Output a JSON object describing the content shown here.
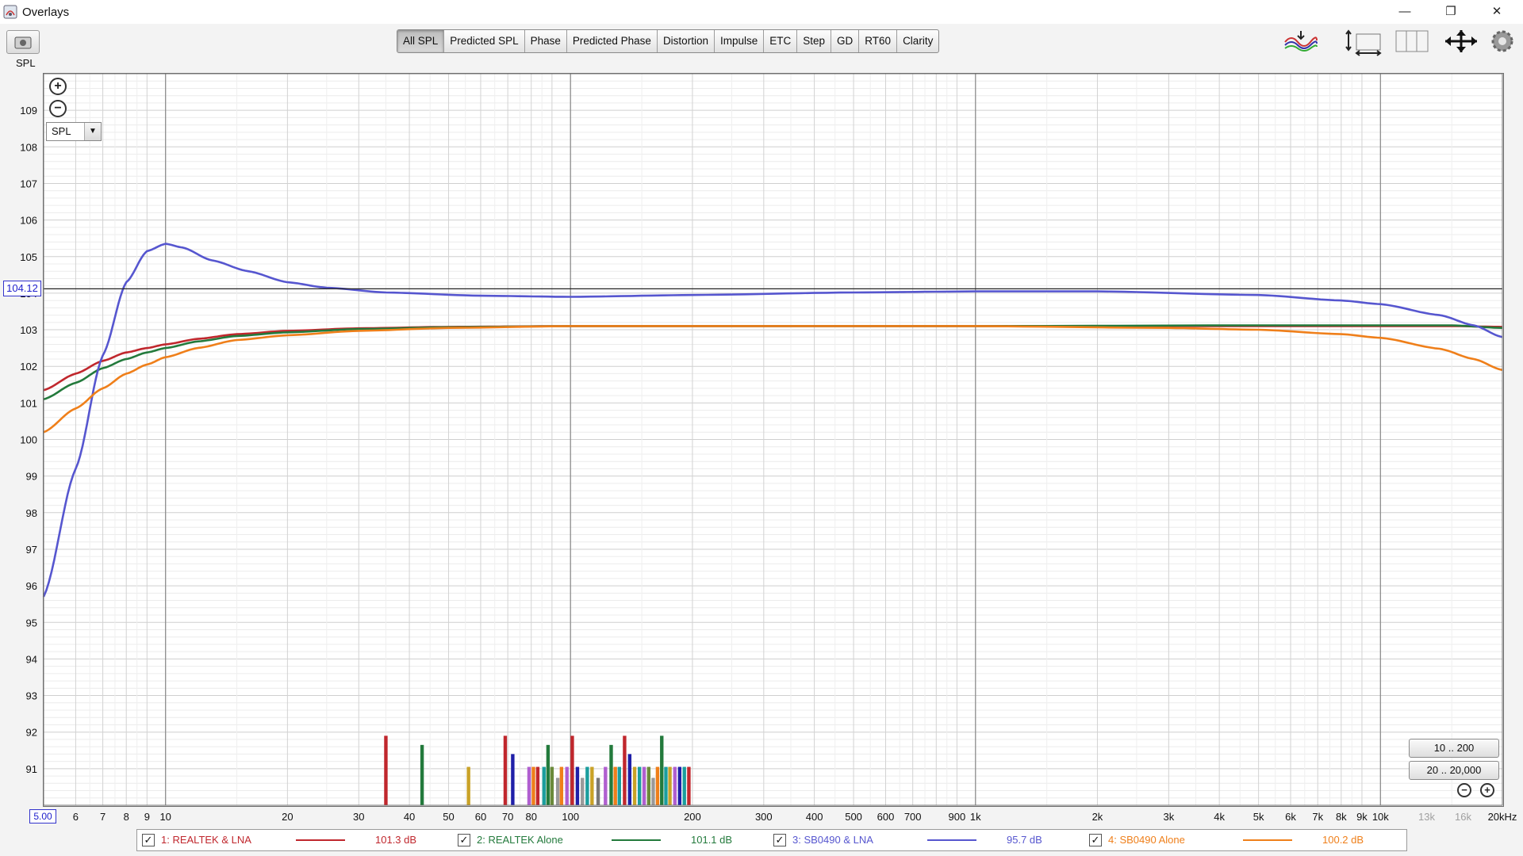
{
  "window": {
    "title": "Overlays",
    "controls": [
      "—",
      "❐",
      "✕"
    ]
  },
  "toolbar": {
    "spl_label": "SPL",
    "tabs": [
      "All SPL",
      "Predicted SPL",
      "Phase",
      "Predicted Phase",
      "Distortion",
      "Impulse",
      "ETC",
      "Step",
      "GD",
      "RT60",
      "Clarity"
    ],
    "active_tab": "All SPL",
    "right_tools": [
      "overlay-waves-icon",
      "axis-controls-icon",
      "columns-icon",
      "pan-arrows-icon",
      "settings-gear-icon"
    ]
  },
  "plot_controls": {
    "zoom_in": "+",
    "zoom_out": "−",
    "view_select": "SPL",
    "range_buttons": [
      "10 .. 200",
      "20 .. 20,000"
    ],
    "cursor_value": "104.12",
    "x_start": "5.00"
  },
  "colors": {
    "red": "#c0272d",
    "green": "#237a3c",
    "blue": "#5656cf",
    "orange": "#ef7f1a"
  },
  "chart_data": {
    "type": "line",
    "xscale": "log",
    "xlim": [
      5,
      20000
    ],
    "ylim": [
      90,
      110
    ],
    "ylabel": "SPL",
    "y_ticks": [
      91,
      92,
      93,
      94,
      95,
      96,
      97,
      98,
      99,
      100,
      101,
      102,
      103,
      104,
      105,
      106,
      107,
      108,
      109
    ],
    "x_ticks": [
      {
        "v": 6,
        "l": "6"
      },
      {
        "v": 7,
        "l": "7"
      },
      {
        "v": 8,
        "l": "8"
      },
      {
        "v": 9,
        "l": "9"
      },
      {
        "v": 10,
        "l": "10"
      },
      {
        "v": 20,
        "l": "20"
      },
      {
        "v": 30,
        "l": "30"
      },
      {
        "v": 40,
        "l": "40"
      },
      {
        "v": 50,
        "l": "50"
      },
      {
        "v": 60,
        "l": "60"
      },
      {
        "v": 70,
        "l": "70"
      },
      {
        "v": 80,
        "l": "80"
      },
      {
        "v": 100,
        "l": "100"
      },
      {
        "v": 200,
        "l": "200"
      },
      {
        "v": 300,
        "l": "300"
      },
      {
        "v": 400,
        "l": "400"
      },
      {
        "v": 500,
        "l": "500"
      },
      {
        "v": 600,
        "l": "600"
      },
      {
        "v": 700,
        "l": "700"
      },
      {
        "v": 900,
        "l": "900"
      },
      {
        "v": 1000,
        "l": "1k"
      },
      {
        "v": 2000,
        "l": "2k"
      },
      {
        "v": 3000,
        "l": "3k"
      },
      {
        "v": 4000,
        "l": "4k"
      },
      {
        "v": 5000,
        "l": "5k"
      },
      {
        "v": 6000,
        "l": "6k"
      },
      {
        "v": 7000,
        "l": "7k"
      },
      {
        "v": 8000,
        "l": "8k"
      },
      {
        "v": 9000,
        "l": "9k"
      },
      {
        "v": 10000,
        "l": "10k"
      },
      {
        "v": 13000,
        "l": "13k",
        "faded": true
      },
      {
        "v": 16000,
        "l": "16k",
        "faded": true
      },
      {
        "v": 20000,
        "l": "20kHz"
      }
    ],
    "cursor_y": 104.12,
    "series": [
      {
        "name": "1: REALTEK & LNA",
        "color": "#c0272d",
        "value_label": "101.3 dB",
        "points": [
          [
            5,
            101.35
          ],
          [
            6,
            101.8
          ],
          [
            7,
            102.15
          ],
          [
            8,
            102.38
          ],
          [
            9,
            102.5
          ],
          [
            10,
            102.6
          ],
          [
            12,
            102.75
          ],
          [
            15,
            102.88
          ],
          [
            20,
            102.97
          ],
          [
            30,
            103.04
          ],
          [
            50,
            103.08
          ],
          [
            100,
            103.1
          ],
          [
            1000,
            103.1
          ],
          [
            5000,
            103.1
          ],
          [
            10000,
            103.1
          ],
          [
            15000,
            103.1
          ],
          [
            20000,
            103.08
          ]
        ]
      },
      {
        "name": "2: REALTEK Alone",
        "color": "#237a3c",
        "value_label": "101.1 dB",
        "points": [
          [
            5,
            101.1
          ],
          [
            6,
            101.55
          ],
          [
            7,
            101.95
          ],
          [
            8,
            102.2
          ],
          [
            9,
            102.38
          ],
          [
            10,
            102.5
          ],
          [
            12,
            102.68
          ],
          [
            15,
            102.83
          ],
          [
            20,
            102.93
          ],
          [
            30,
            103.02
          ],
          [
            50,
            103.07
          ],
          [
            100,
            103.1
          ],
          [
            1000,
            103.1
          ],
          [
            5000,
            103.12
          ],
          [
            10000,
            103.12
          ],
          [
            15000,
            103.12
          ],
          [
            20000,
            103.05
          ]
        ]
      },
      {
        "name": "3: SB0490 & LNA",
        "color": "#5656cf",
        "value_label": "95.7 dB",
        "points": [
          [
            5,
            95.7
          ],
          [
            6,
            99.2
          ],
          [
            7,
            102.3
          ],
          [
            8,
            104.3
          ],
          [
            9,
            105.15
          ],
          [
            10,
            105.35
          ],
          [
            11,
            105.25
          ],
          [
            13,
            104.9
          ],
          [
            16,
            104.6
          ],
          [
            20,
            104.3
          ],
          [
            25,
            104.15
          ],
          [
            35,
            104.02
          ],
          [
            60,
            103.93
          ],
          [
            100,
            103.9
          ],
          [
            200,
            103.95
          ],
          [
            500,
            104.02
          ],
          [
            1000,
            104.05
          ],
          [
            2000,
            104.05
          ],
          [
            5000,
            103.95
          ],
          [
            8000,
            103.8
          ],
          [
            10000,
            103.7
          ],
          [
            14000,
            103.4
          ],
          [
            17000,
            103.12
          ],
          [
            20000,
            102.8
          ]
        ]
      },
      {
        "name": "4: SB0490 Alone",
        "color": "#ef7f1a",
        "value_label": "100.2 dB",
        "points": [
          [
            5,
            100.2
          ],
          [
            6,
            100.85
          ],
          [
            7,
            101.4
          ],
          [
            8,
            101.8
          ],
          [
            9,
            102.05
          ],
          [
            10,
            102.25
          ],
          [
            12,
            102.5
          ],
          [
            15,
            102.72
          ],
          [
            20,
            102.85
          ],
          [
            30,
            102.97
          ],
          [
            50,
            103.05
          ],
          [
            100,
            103.1
          ],
          [
            1000,
            103.1
          ],
          [
            3000,
            103.05
          ],
          [
            5000,
            103.0
          ],
          [
            8000,
            102.88
          ],
          [
            10000,
            102.78
          ],
          [
            14000,
            102.48
          ],
          [
            17000,
            102.2
          ],
          [
            20000,
            101.9
          ]
        ]
      }
    ],
    "distortion_bars": [
      {
        "f": 35,
        "v": 91.9,
        "c": "#c0272d"
      },
      {
        "f": 43,
        "v": 91.65,
        "c": "#237a3c"
      },
      {
        "f": 56,
        "v": 91.05,
        "c": "#c9a227"
      },
      {
        "f": 69,
        "v": 91.9,
        "c": "#c0272d"
      },
      {
        "f": 72,
        "v": 91.4,
        "c": "#1f1fa8"
      },
      {
        "f": 79,
        "v": 91.05,
        "c": "#b05fd0"
      },
      {
        "f": 81,
        "v": 91.05,
        "c": "#ef7f1a"
      },
      {
        "f": 83,
        "v": 91.05,
        "c": "#c0272d"
      },
      {
        "f": 86,
        "v": 91.05,
        "c": "#1b9e9e"
      },
      {
        "f": 88,
        "v": 91.65,
        "c": "#237a3c"
      },
      {
        "f": 90,
        "v": 91.05,
        "c": "#6b8a3a"
      },
      {
        "f": 93,
        "v": 90.75,
        "c": "#999999"
      },
      {
        "f": 95,
        "v": 91.05,
        "c": "#ef7f1a"
      },
      {
        "f": 98,
        "v": 91.05,
        "c": "#b05fd0"
      },
      {
        "f": 101,
        "v": 91.9,
        "c": "#c0272d"
      },
      {
        "f": 104,
        "v": 91.05,
        "c": "#1f1fa8"
      },
      {
        "f": 107,
        "v": 90.75,
        "c": "#9a9a9a"
      },
      {
        "f": 110,
        "v": 91.05,
        "c": "#1b9e9e"
      },
      {
        "f": 113,
        "v": 91.05,
        "c": "#c9a227"
      },
      {
        "f": 117,
        "v": 90.75,
        "c": "#777777"
      },
      {
        "f": 122,
        "v": 91.05,
        "c": "#b05fd0"
      },
      {
        "f": 126,
        "v": 91.65,
        "c": "#237a3c"
      },
      {
        "f": 129,
        "v": 91.05,
        "c": "#ef7f1a"
      },
      {
        "f": 132,
        "v": 91.05,
        "c": "#1b9e9e"
      },
      {
        "f": 136,
        "v": 91.9,
        "c": "#c0272d"
      },
      {
        "f": 140,
        "v": 91.4,
        "c": "#1f1fa8"
      },
      {
        "f": 144,
        "v": 91.05,
        "c": "#c9a227"
      },
      {
        "f": 148,
        "v": 91.05,
        "c": "#1b9e9e"
      },
      {
        "f": 152,
        "v": 91.05,
        "c": "#b05fd0"
      },
      {
        "f": 156,
        "v": 91.05,
        "c": "#6b8a3a"
      },
      {
        "f": 160,
        "v": 90.75,
        "c": "#999999"
      },
      {
        "f": 164,
        "v": 91.05,
        "c": "#ef7f1a"
      },
      {
        "f": 168,
        "v": 91.9,
        "c": "#237a3c"
      },
      {
        "f": 172,
        "v": 91.05,
        "c": "#1b9e9e"
      },
      {
        "f": 176,
        "v": 91.05,
        "c": "#c9a227"
      },
      {
        "f": 181,
        "v": 91.05,
        "c": "#b05fd0"
      },
      {
        "f": 186,
        "v": 91.05,
        "c": "#1f1fa8"
      },
      {
        "f": 191,
        "v": 91.05,
        "c": "#1b9e9e"
      },
      {
        "f": 196,
        "v": 91.05,
        "c": "#c0272d"
      }
    ]
  }
}
